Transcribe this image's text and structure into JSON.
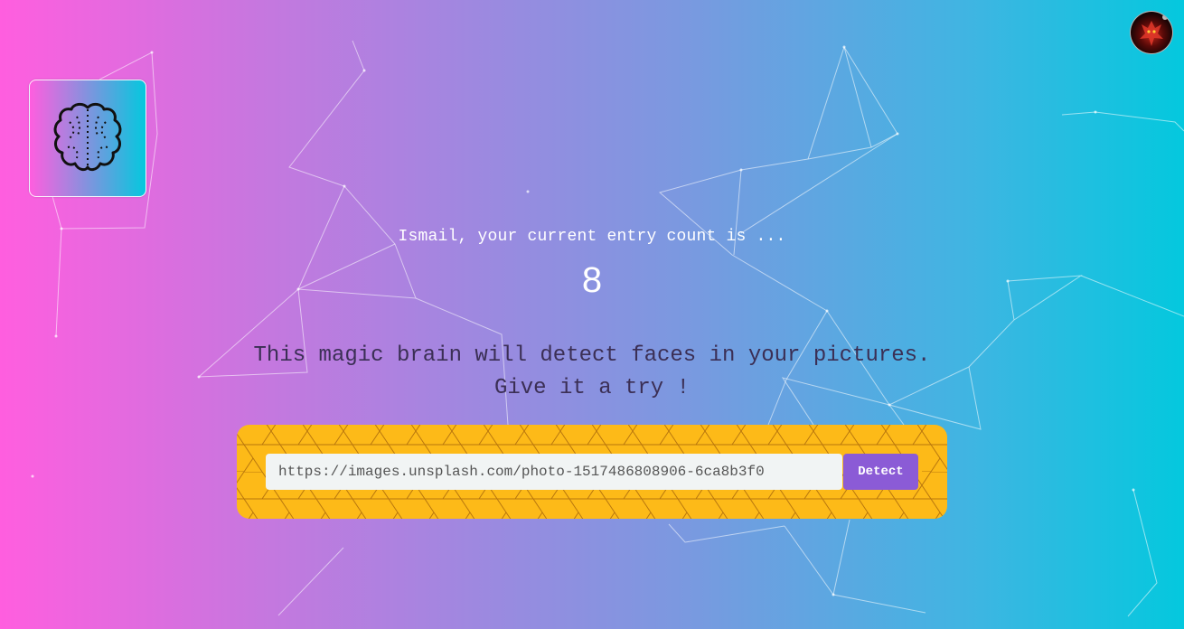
{
  "entry": {
    "message": "Ismail, your current entry count is ...",
    "count": "8"
  },
  "tagline": {
    "line1": "This magic brain will detect faces in your pictures.",
    "line2": "Give it a try !"
  },
  "form": {
    "url_value": "https://images.unsplash.com/photo-1517486808906-6ca8b3f0",
    "detect_label": "Detect"
  },
  "icons": {
    "logo": "brain-icon",
    "profile": "avatar"
  },
  "colors": {
    "gradient_start": "#ff5edf",
    "gradient_end": "#04c8de",
    "form_background": "#fdba18",
    "detect_button": "#8b5bd6"
  }
}
